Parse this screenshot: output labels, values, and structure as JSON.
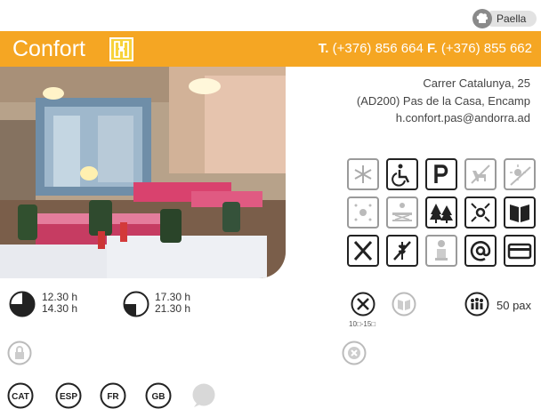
{
  "badge": {
    "label": "Paella",
    "icon": "chef-hat-icon"
  },
  "header": {
    "name": "Confort",
    "phone_label": "T.",
    "phone": "(+376) 856 664",
    "fax_label": "F.",
    "fax": "(+376) 855 662",
    "bar_color": "#f5a623"
  },
  "address": {
    "street": "Carrer Catalunya, 25",
    "city": "(AD200) Pas de la Casa, Encamp",
    "email": "h.confort.pas@andorra.ad"
  },
  "services": [
    [
      "snowflake-icon",
      "wheelchair-icon",
      "parking-icon",
      "dog-crossed-icon",
      "sun-crossed-icon"
    ],
    [
      "sun-dim-icon",
      "terrace-icon",
      "trees-icon",
      "center-icon",
      "book-menu-icon"
    ],
    [
      "cutlery-icon",
      "wheat-crossed-icon",
      "chef-icon",
      "at-icon",
      "credit-card-icon"
    ]
  ],
  "hours": {
    "shift1_start": "12.30 h",
    "shift1_end": "14.30 h",
    "shift2_start": "17.30 h",
    "shift2_end": "21.30 h"
  },
  "info": {
    "price_range": "10□-15□",
    "capacity": "50 pax"
  },
  "languages": [
    "CAT",
    "ESP",
    "FR",
    "GB"
  ]
}
